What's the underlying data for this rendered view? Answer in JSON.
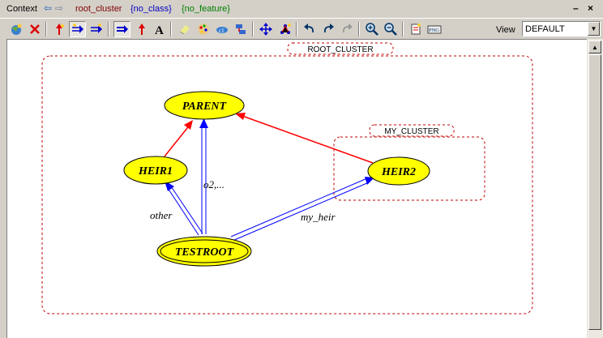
{
  "context_bar": {
    "label": "Context",
    "cluster": "root_cluster",
    "class": "{no_class}",
    "feature": "{no_feature}",
    "colors": {
      "cluster": "#800000",
      "class": "#0000c0",
      "feature": "#008000"
    }
  },
  "window_controls": {
    "minimize": "–",
    "close": "×"
  },
  "toolbar": {
    "icons": [
      "new-diagram-icon",
      "delete-icon",
      "inheritance-link-icon",
      "supplier-link-icon",
      "client-link-icon",
      "create-inheritance-icon",
      "create-aggregation-icon",
      "text-icon",
      "eraser-icon",
      "color-icon",
      "cluster-icon",
      "figure-icon",
      "move-icon",
      "physics-icon",
      "undo-icon",
      "redo-icon",
      "redo-disabled-icon",
      "zoom-in-icon",
      "zoom-out-icon",
      "export-icon",
      "png-icon"
    ],
    "view_label": "View",
    "view_value": "DEFAULT"
  },
  "diagram": {
    "clusters": [
      {
        "name": "ROOT_CLUSTER"
      },
      {
        "name": "MY_CLUSTER"
      }
    ],
    "classes": [
      {
        "name": "PARENT"
      },
      {
        "name": "HEIR1"
      },
      {
        "name": "HEIR2"
      },
      {
        "name": "TESTROOT",
        "root": true
      }
    ],
    "links": [
      {
        "label": "other"
      },
      {
        "label": "o2,..."
      },
      {
        "label": "my_heir"
      }
    ],
    "colors": {
      "node": "#ffff00",
      "inheritance": "#ff0000",
      "client": "#0000ff",
      "cluster_border": "#c00000"
    }
  }
}
